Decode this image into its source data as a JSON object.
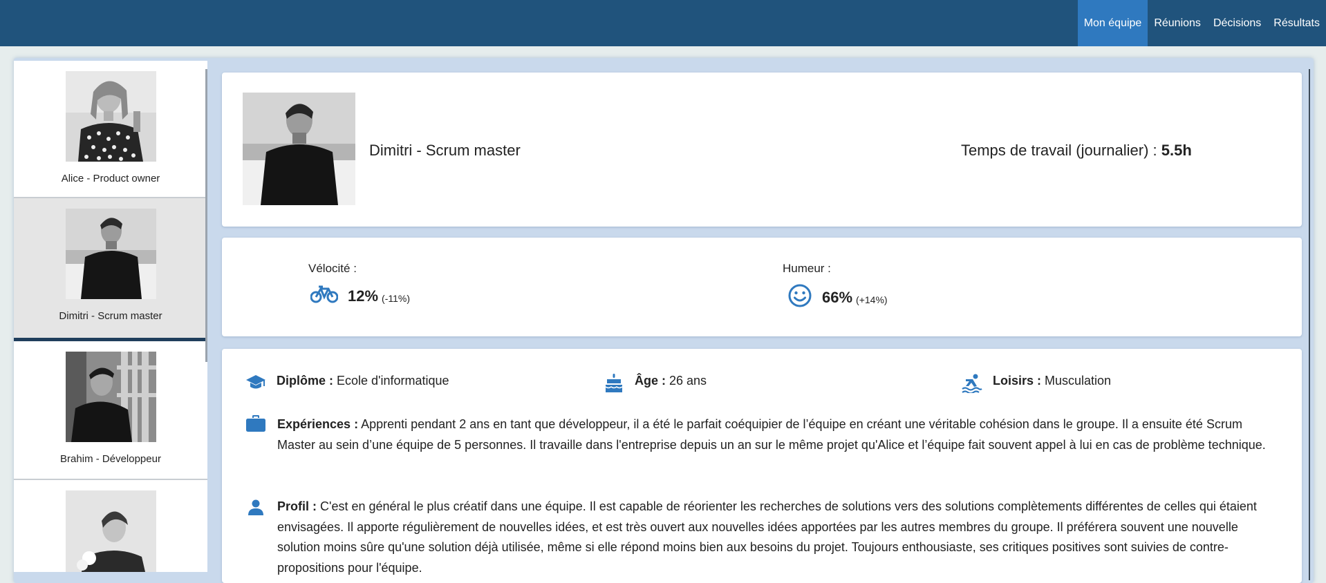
{
  "nav": {
    "items": [
      {
        "label": "Mon équipe",
        "active": true
      },
      {
        "label": "Réunions"
      },
      {
        "label": "Décisions"
      },
      {
        "label": "Résultats"
      }
    ]
  },
  "sidebar": {
    "members": [
      {
        "name": "Alice - Product owner"
      },
      {
        "name": "Dimitri - Scrum master"
      },
      {
        "name": "Brahim - Développeur"
      },
      {
        "name": ""
      }
    ]
  },
  "profile": {
    "name": "Dimitri - Scrum master",
    "worktime_label": "Temps de travail (journalier) :",
    "worktime_value": "5.5h"
  },
  "metrics": {
    "velocity": {
      "label": "Vélocité :",
      "value": "12%",
      "delta": "(-11%)",
      "icon": "bicycle-icon"
    },
    "mood": {
      "label": "Humeur :",
      "value": "66%",
      "delta": "(+14%)",
      "icon": "smiley-icon"
    }
  },
  "details": {
    "diploma": {
      "label": "Diplôme :",
      "value": "Ecole d'informatique",
      "icon": "graduation-cap-icon"
    },
    "age": {
      "label": "Âge :",
      "value": "26 ans",
      "icon": "birthday-cake-icon"
    },
    "hobbies": {
      "label": "Loisirs :",
      "value": "Musculation",
      "icon": "swimmer-icon"
    },
    "experience": {
      "label": "Expériences :",
      "text": "Apprenti pendant 2 ans en tant que développeur, il a été le parfait coéquipier de l’équipe en créant une véritable cohésion dans le groupe. Il a ensuite été Scrum Master au sein d’une équipe de 5 personnes. Il travaille dans l'entreprise depuis un an sur le même projet qu'Alice et l’équipe fait souvent appel à lui en cas de problème technique.",
      "icon": "briefcase-icon"
    },
    "profile": {
      "label": "Profil :",
      "text": "C'est en général le plus créatif dans une équipe. Il est capable de réorienter les recherches de solutions vers des solutions complètements différentes de celles qui étaient envisagées. Il apporte régulièrement de nouvelles idées, et est très ouvert aux nouvelles idées apportées par les autres membres du groupe. Il préférera souvent une nouvelle solution moins sûre qu'une solution déjà utilisée, même si elle répond moins bien aux besoins du projet. Toujours enthousiaste, ses critiques positives sont suivies de contre-propositions pour l'équipe.",
      "icon": "user-icon"
    }
  },
  "colors": {
    "navbar": "#20537c",
    "nav_active": "#2f79bf",
    "icon_blue": "#2f79bf",
    "selected_bar": "#1f3e5c"
  }
}
